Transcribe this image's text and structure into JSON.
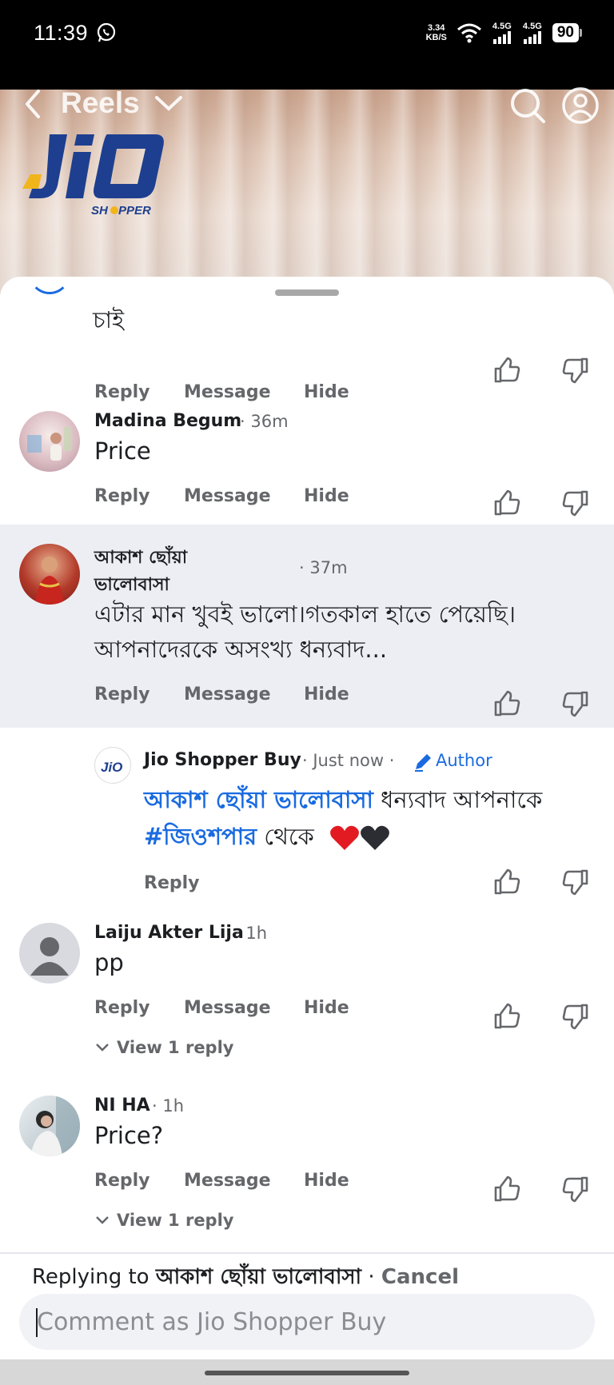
{
  "status_bar": {
    "time": "11:39",
    "net_speed_value": "3.34",
    "net_speed_unit": "KB/S",
    "signal1_label": "4.5G",
    "signal2_label": "4.5G",
    "battery": "90"
  },
  "header": {
    "title": "Reels",
    "brand_logo_text": "JiO",
    "brand_logo_sub": "SHOPPER"
  },
  "comments": [
    {
      "text": "চাই",
      "actions": {
        "reply": "Reply",
        "message": "Message",
        "hide": "Hide"
      }
    },
    {
      "name": "Madina Begum",
      "time": "· 36m",
      "text": "Price",
      "actions": {
        "reply": "Reply",
        "message": "Message",
        "hide": "Hide"
      }
    },
    {
      "name_line1": "আকাশ ছোঁয়া",
      "name_line2": "ভালোবাসা",
      "time": "· 37m",
      "text_line1": "এটার মান খুবই ভালো।গতকাল হাতে পেয়েছি।",
      "text_line2": "আপনাদেরকে অসংখ্য ধন্যবাদ...",
      "actions": {
        "reply": "Reply",
        "message": "Message",
        "hide": "Hide"
      }
    },
    {
      "name": "Jio Shopper Buy",
      "time": "· Just now ·",
      "author_label": "Author",
      "mention": "আকাশ ছোঁয়া ভালোবাসা",
      "text_after_mention": " ধন্যবাদ আপনাকে",
      "hashtag": "#জিওশপার",
      "text_after_hashtag": " থেকে",
      "actions": {
        "reply": "Reply"
      }
    },
    {
      "name": "Laiju Akter Lija",
      "time": "· 1h",
      "text": "pp",
      "actions": {
        "reply": "Reply",
        "message": "Message",
        "hide": "Hide"
      },
      "view_replies": "View 1 reply"
    },
    {
      "name": "NI HA",
      "time": "· 1h",
      "text": "Price?",
      "actions": {
        "reply": "Reply",
        "message": "Message",
        "hide": "Hide"
      },
      "view_replies": "View 1 reply"
    }
  ],
  "reply_box": {
    "replying_prefix": "Replying to ",
    "replying_to": "আকাশ ছোঁয়া ভালোবাসা",
    "separator": " · ",
    "cancel": "Cancel",
    "placeholder": "Comment as Jio Shopper Buy"
  },
  "colors": {
    "accent": "#1a6be0",
    "highlight": "#eceef3",
    "muted": "#65676b"
  }
}
